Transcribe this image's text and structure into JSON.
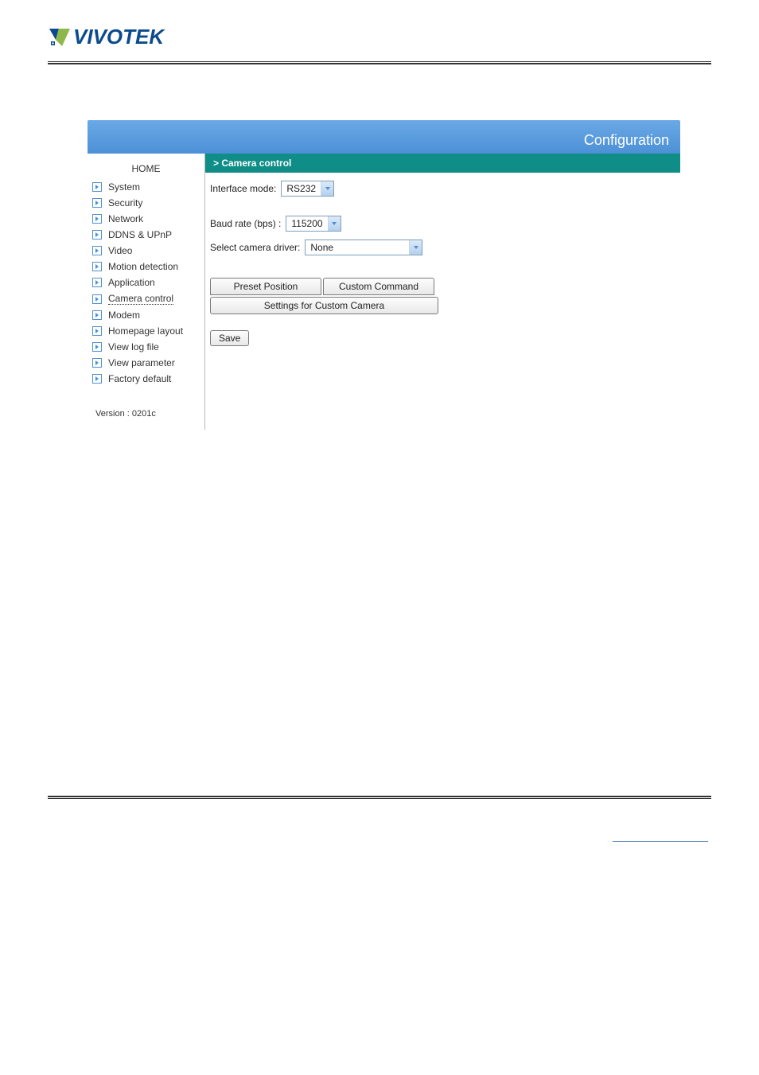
{
  "brand": {
    "name": "VIVOTEK"
  },
  "header": {
    "title": "Configuration"
  },
  "sidebar": {
    "home_label": "HOME",
    "items": [
      {
        "label": "System",
        "active": false
      },
      {
        "label": "Security",
        "active": false
      },
      {
        "label": "Network",
        "active": false
      },
      {
        "label": "DDNS & UPnP",
        "active": false
      },
      {
        "label": "Video",
        "active": false
      },
      {
        "label": "Motion detection",
        "active": false
      },
      {
        "label": "Application",
        "active": false
      },
      {
        "label": "Camera control",
        "active": true
      },
      {
        "label": "Modem",
        "active": false
      },
      {
        "label": "Homepage layout",
        "active": false
      },
      {
        "label": "View log file",
        "active": false
      },
      {
        "label": "View parameter",
        "active": false
      },
      {
        "label": "Factory default",
        "active": false
      }
    ],
    "version_label": "Version : 0201c"
  },
  "main": {
    "section_title": "> Camera control",
    "interface_mode": {
      "label": "Interface mode:",
      "value": "RS232"
    },
    "baud_rate": {
      "label": "Baud rate (bps) :",
      "value": "115200"
    },
    "camera_driver": {
      "label": "Select camera driver:",
      "value": "None"
    },
    "buttons": {
      "preset_position": "Preset Position",
      "custom_command": "Custom Command",
      "settings_custom": "Settings for Custom Camera",
      "save": "Save"
    }
  }
}
